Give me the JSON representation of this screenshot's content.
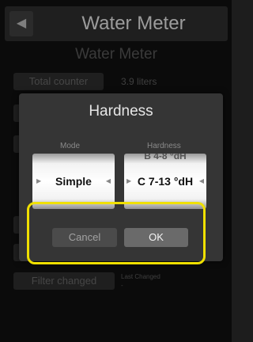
{
  "header": {
    "back_glyph": "◀",
    "title": "Water Meter"
  },
  "main": {
    "subtitle": "Water Meter",
    "total_counter_label": "Total counter",
    "total_counter_value": "3.9 liters",
    "filter_changed_label": "Filter changed",
    "last_changed_label": "Last Changed",
    "last_changed_value": "-"
  },
  "dialog": {
    "title": "Hardness",
    "mode_label": "Mode",
    "hardness_label": "Hardness",
    "mode_value": "Simple",
    "hardness_value": "C 7-13 °dH",
    "hardness_previous": "B 4-8 °dH",
    "cancel_label": "Cancel",
    "ok_label": "OK"
  },
  "colors": {
    "highlight": "#f0e000"
  },
  "icons": {
    "back": "back-arrow-icon",
    "left_arrow": "picker-left-arrow-icon",
    "right_arrow": "picker-right-arrow-icon"
  }
}
